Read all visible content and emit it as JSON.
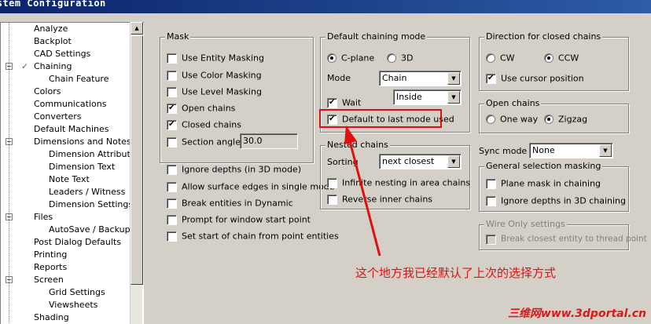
{
  "window": {
    "title": "ystem Configuration"
  },
  "tree": {
    "items": [
      {
        "label": "Analyze",
        "level": 1
      },
      {
        "label": "Backplot",
        "level": 1
      },
      {
        "label": "CAD Settings",
        "level": 1
      },
      {
        "label": "Chaining",
        "level": 1,
        "expanded": true,
        "selected": true
      },
      {
        "label": "Chain Feature",
        "level": 2
      },
      {
        "label": "Colors",
        "level": 1
      },
      {
        "label": "Communications",
        "level": 1
      },
      {
        "label": "Converters",
        "level": 1
      },
      {
        "label": "Default Machines",
        "level": 1
      },
      {
        "label": "Dimensions and Notes",
        "level": 1,
        "expanded": true
      },
      {
        "label": "Dimension Attributes",
        "level": 2
      },
      {
        "label": "Dimension Text",
        "level": 2
      },
      {
        "label": "Note Text",
        "level": 2
      },
      {
        "label": "Leaders / Witness",
        "level": 2
      },
      {
        "label": "Dimension Settings",
        "level": 2
      },
      {
        "label": "Files",
        "level": 1,
        "expanded": true
      },
      {
        "label": "AutoSave / Backup",
        "level": 2
      },
      {
        "label": "Post Dialog Defaults",
        "level": 1
      },
      {
        "label": "Printing",
        "level": 1
      },
      {
        "label": "Reports",
        "level": 1
      },
      {
        "label": "Screen",
        "level": 1,
        "expanded": true
      },
      {
        "label": "Grid Settings",
        "level": 2
      },
      {
        "label": "Viewsheets",
        "level": 2
      },
      {
        "label": "Shading",
        "level": 1
      }
    ]
  },
  "mask": {
    "title": "Mask",
    "use_entity_masking": {
      "label": "Use Entity Masking",
      "checked": false
    },
    "use_color_masking": {
      "label": "Use Color Masking",
      "checked": false
    },
    "use_level_masking": {
      "label": "Use Level Masking",
      "checked": false
    },
    "open_chains": {
      "label": "Open chains",
      "checked": true
    },
    "closed_chains": {
      "label": "Closed chains",
      "checked": true
    },
    "section_angle": {
      "label": "Section angle",
      "checked": false,
      "value": "30.0"
    },
    "ignore_depths": {
      "label": "Ignore depths (in 3D mode)",
      "checked": false
    },
    "allow_surface_edges": {
      "label": "Allow surface edges in single mode",
      "checked": false
    },
    "break_entities": {
      "label": "Break entities in Dynamic",
      "checked": false
    },
    "prompt_window": {
      "label": "Prompt for window start point",
      "checked": false
    },
    "set_start": {
      "label": "Set start of chain from point entities",
      "checked": false
    }
  },
  "default_chaining": {
    "title": "Default chaining mode",
    "cplane": {
      "label": "C-plane",
      "selected": true
    },
    "three_d": {
      "label": "3D",
      "selected": false
    },
    "mode_label": "Mode",
    "mode_value": "Chain",
    "wait": {
      "label": "Wait",
      "checked": true
    },
    "wait_value": "Inside",
    "default_last": {
      "label": "Default to last mode used",
      "checked": true
    }
  },
  "nested": {
    "title": "Nested chains",
    "sorting_label": "Sorting",
    "sorting_value": "next closest",
    "infinite": {
      "label": "Infinite nesting in area chains",
      "checked": false
    },
    "reverse": {
      "label": "Reverse inner chains",
      "checked": false
    }
  },
  "direction": {
    "title": "Direction for closed chains",
    "cw": {
      "label": "CW",
      "selected": false
    },
    "ccw": {
      "label": "CCW",
      "selected": true
    },
    "use_cursor": {
      "label": "Use cursor position",
      "checked": true
    }
  },
  "open_chains_group": {
    "title": "Open chains",
    "one_way": {
      "label": "One way",
      "selected": false
    },
    "zigzag": {
      "label": "Zigzag",
      "selected": true
    }
  },
  "sync": {
    "label": "Sync mode",
    "value": "None"
  },
  "general_masking": {
    "title": "General selection masking",
    "plane_mask": {
      "label": "Plane mask in chaining",
      "checked": false
    },
    "ignore_depths_3d": {
      "label": "Ignore depths in 3D chaining",
      "checked": false
    }
  },
  "wire_only": {
    "title": "Wire Only settings",
    "break_closest": {
      "label": "Break closest entity to thread point",
      "checked": false
    }
  },
  "annotation_text": "这个地方我已经默认了上次的选择方式",
  "watermark": "三维网www.3dportal.cn",
  "colors": {
    "annotation": "#e01010",
    "titlebar": "#0a246a"
  }
}
